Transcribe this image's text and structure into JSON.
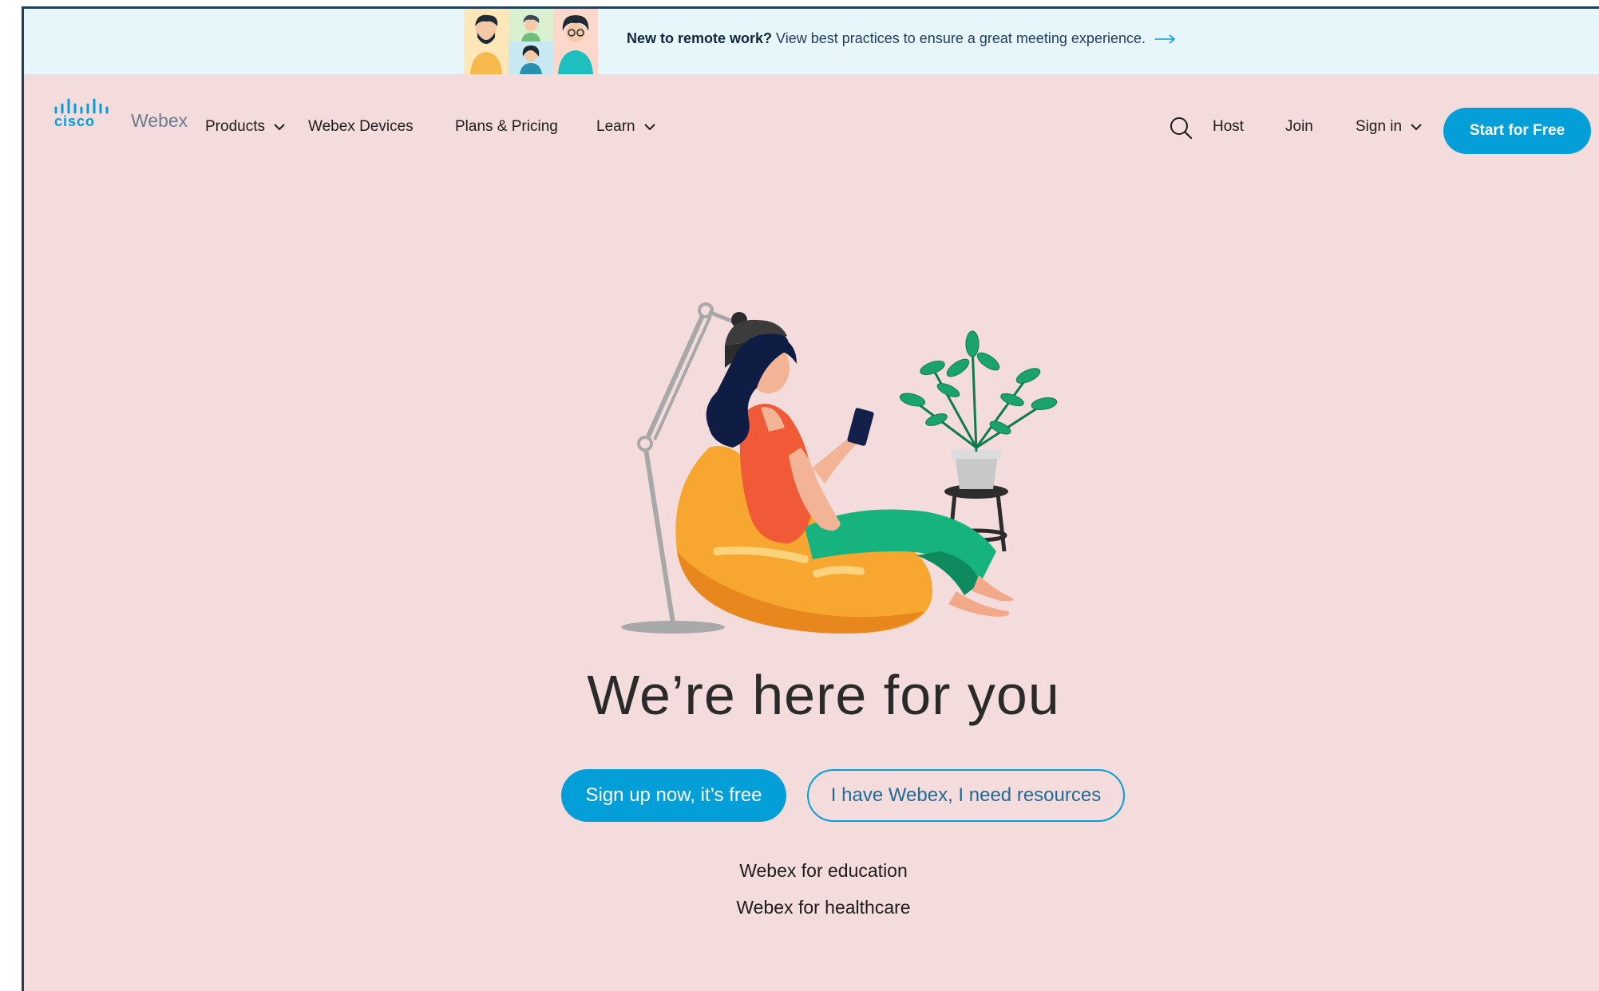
{
  "promo": {
    "bold_text": "New to remote work?",
    "text": "View best practices to ensure a great meeting experience."
  },
  "nav": {
    "logo_cisco": "cisco",
    "logo_webex": "Webex",
    "products": "Products",
    "devices": "Webex Devices",
    "plans": "Plans & Pricing",
    "learn": "Learn",
    "host": "Host",
    "join": "Join",
    "signin": "Sign in",
    "start": "Start for Free"
  },
  "hero": {
    "title": "We’re here for you",
    "primary_cta": "Sign up now, it’s free",
    "secondary_cta": "I have Webex, I need resources",
    "link_education": "Webex for education",
    "link_healthcare": "Webex for healthcare"
  },
  "colors": {
    "brand": "#049fd9",
    "page_bg": "#f5dcdc",
    "banner_bg": "#e6f6fb"
  },
  "icons": [
    "search-icon",
    "chevron-down-icon",
    "arrow-right-icon",
    "cisco-logo-icon"
  ]
}
